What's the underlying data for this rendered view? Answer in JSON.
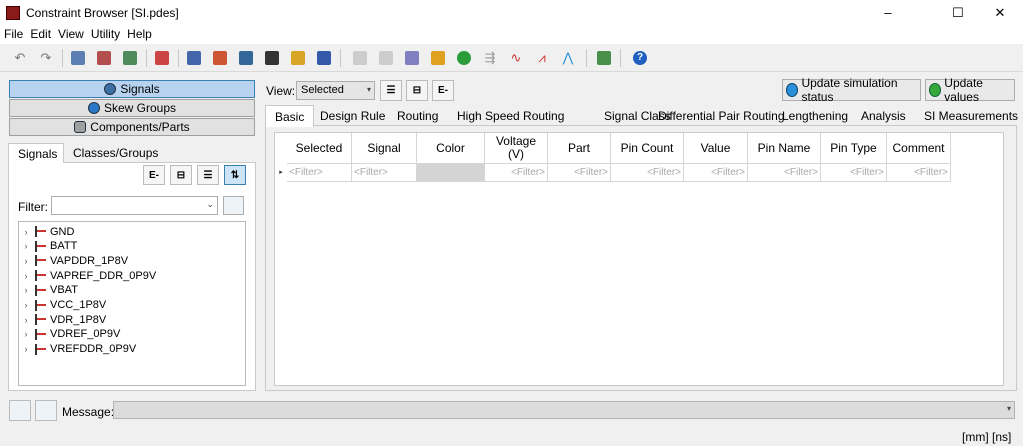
{
  "window": {
    "title": "Constraint Browser [SI.pdes]",
    "controls": [
      "–",
      "☐",
      "✕"
    ]
  },
  "menu": [
    {
      "label": "File"
    },
    {
      "label": "Edit"
    },
    {
      "label": "View"
    },
    {
      "label": "Utility"
    },
    {
      "label": "Help"
    }
  ],
  "toolbar": {
    "icons": [
      "undo-icon",
      "redo-icon",
      "net-tool-1-icon",
      "net-tool-2-icon",
      "net-tool-3-icon",
      "net-tool-4-icon",
      "chart-tool-1-icon",
      "chart-tool-2-icon",
      "chart-tool-3-icon",
      "export-icon",
      "edit-icon",
      "save-icon",
      "copy-icon",
      "paste-icon",
      "calc-icon",
      "bar-chart-icon",
      "e-icon",
      "share-icon",
      "waveform-1-icon",
      "waveform-2-icon",
      "waveform-3-icon",
      "layout-icon",
      "help-icon"
    ]
  },
  "left": {
    "nav": [
      {
        "label": "Signals",
        "active": true
      },
      {
        "label": "Skew Groups",
        "active": false
      },
      {
        "label": "Components/Parts",
        "active": false
      }
    ],
    "tabs": [
      {
        "label": "Signals",
        "active": true
      },
      {
        "label": "Classes/Groups",
        "active": false
      }
    ],
    "filter_label": "Filter:",
    "filter_value": "",
    "signals": [
      "GND",
      "BATT",
      "VAPDDR_1P8V",
      "VAPREF_DDR_0P9V",
      "VBAT",
      "VCC_1P8V",
      "VDR_1P8V",
      "VDREF_0P9V",
      "VREFDDR_0P9V"
    ]
  },
  "right": {
    "view_label": "View:",
    "view_value": "Selected",
    "update_sim_label": "Update simulation status",
    "update_values_label": "Update values",
    "tabs": [
      {
        "label": "Basic",
        "active": true
      },
      {
        "label": "Design Rule"
      },
      {
        "label": "Routing"
      },
      {
        "label": "High Speed Routing"
      },
      {
        "label": "Signal Class"
      },
      {
        "label": "Differential Pair Routing"
      },
      {
        "label": "Lengthening"
      },
      {
        "label": "Analysis"
      },
      {
        "label": "SI Measurements"
      }
    ],
    "columns": [
      {
        "label": "Selected"
      },
      {
        "label": "Signal"
      },
      {
        "label": "Color"
      },
      {
        "label": "Voltage (V)"
      },
      {
        "label": "Part"
      },
      {
        "label": "Pin Count"
      },
      {
        "label": "Value"
      },
      {
        "label": "Pin Name"
      },
      {
        "label": "Pin Type"
      },
      {
        "label": "Comment"
      }
    ],
    "filter_placeholder": "<Filter>",
    "row_marker": "▸"
  },
  "status": {
    "message_label": "Message:",
    "message_value": "",
    "units": "[mm]  [ns]"
  },
  "colors": {
    "accent": "#b7d3f0",
    "window_bg": "#f0f0f0"
  }
}
